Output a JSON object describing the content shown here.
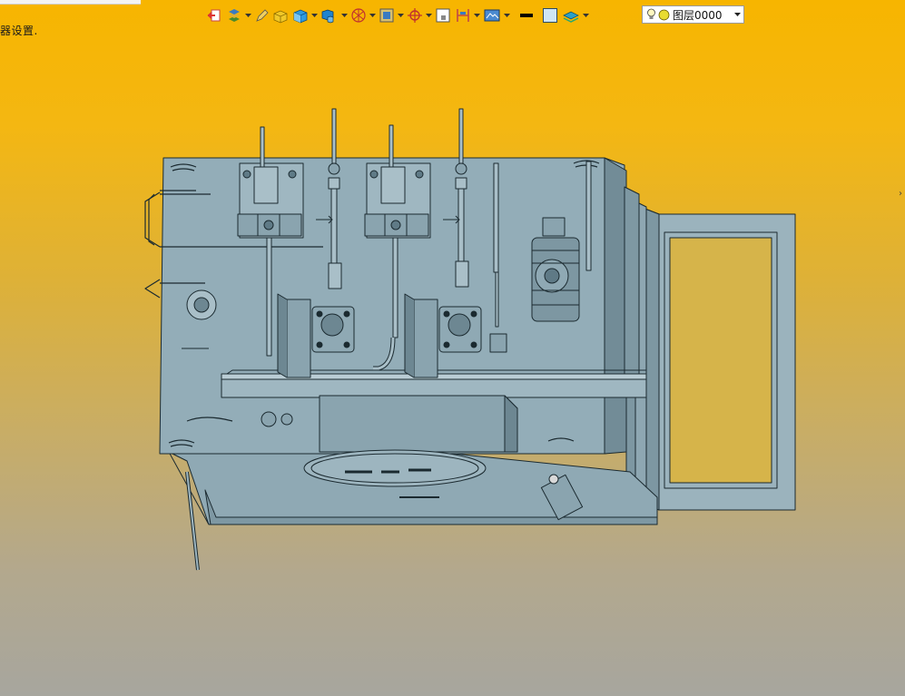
{
  "status": {
    "text": "器设置."
  },
  "toolbar": {
    "buttons": [
      {
        "icon": "exit-icon"
      },
      {
        "icon": "layers-stack-icon"
      },
      {
        "icon": "pencil-icon"
      },
      {
        "icon": "box-highlight-icon"
      },
      {
        "icon": "cube-icon"
      },
      {
        "icon": "shaded-cube-icon"
      },
      {
        "icon": "section-view-icon"
      },
      {
        "icon": "frame-view-icon"
      },
      {
        "icon": "crosshair-icon"
      },
      {
        "icon": "fit-window-icon"
      },
      {
        "icon": "bracket-view-icon"
      },
      {
        "icon": "render-style-icon"
      },
      {
        "icon": "line-weight-icon"
      },
      {
        "icon": "color-swatch-icon"
      },
      {
        "icon": "layer-icon"
      }
    ]
  },
  "layer_select": {
    "value": "图层0000"
  },
  "viewport": {
    "model": "hydraulic-station-assembly"
  },
  "colors": {
    "model_fill": "#8fa9b4",
    "model_dark": "#5f7a86",
    "edge": "#1b2a30"
  }
}
